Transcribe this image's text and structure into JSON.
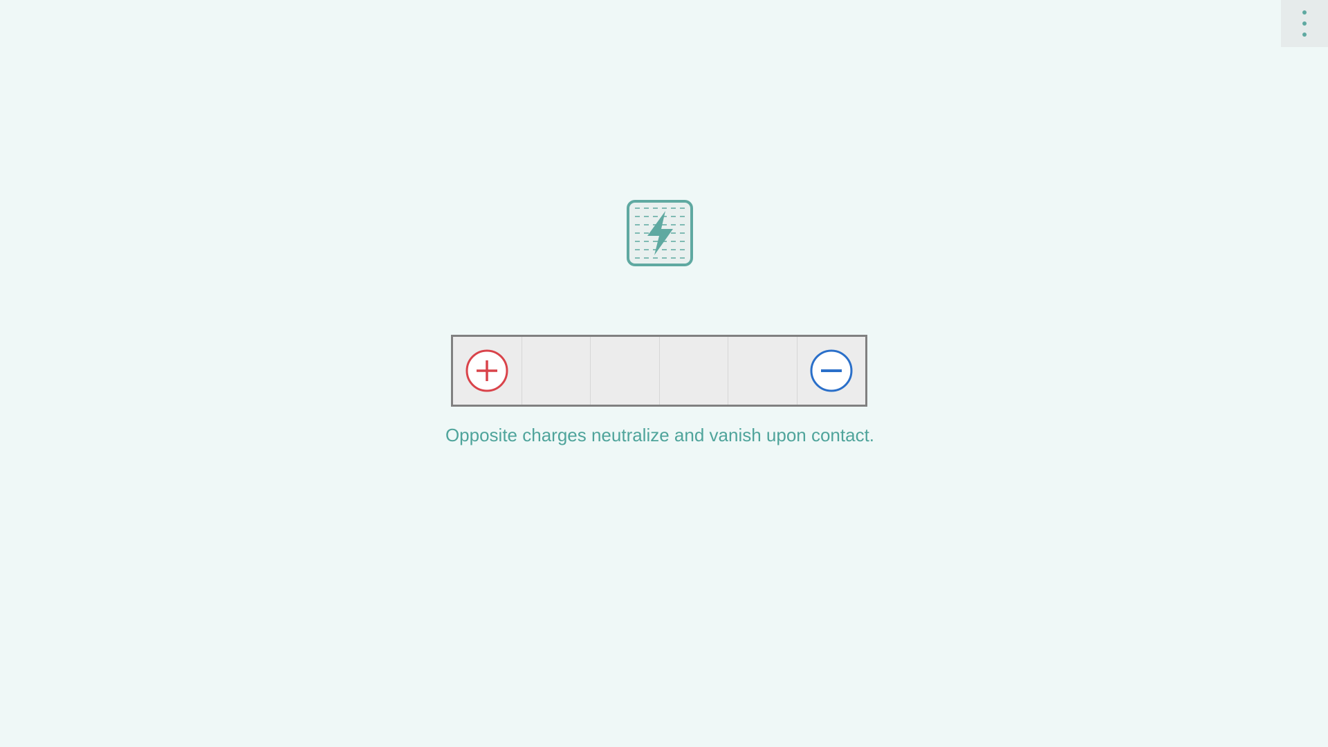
{
  "menu": {
    "icon": "more-vertical-icon"
  },
  "level": {
    "icon": "charge-grid-lightning-icon",
    "accent_color": "#5fa9a1"
  },
  "board": {
    "cells": [
      {
        "content": "positive"
      },
      {
        "content": "empty"
      },
      {
        "content": "empty"
      },
      {
        "content": "empty"
      },
      {
        "content": "empty"
      },
      {
        "content": "negative"
      }
    ],
    "positive_color": "#d9434a",
    "negative_color": "#2a6fc9"
  },
  "hint": {
    "text": "Opposite charges neutralize and vanish upon contact."
  }
}
